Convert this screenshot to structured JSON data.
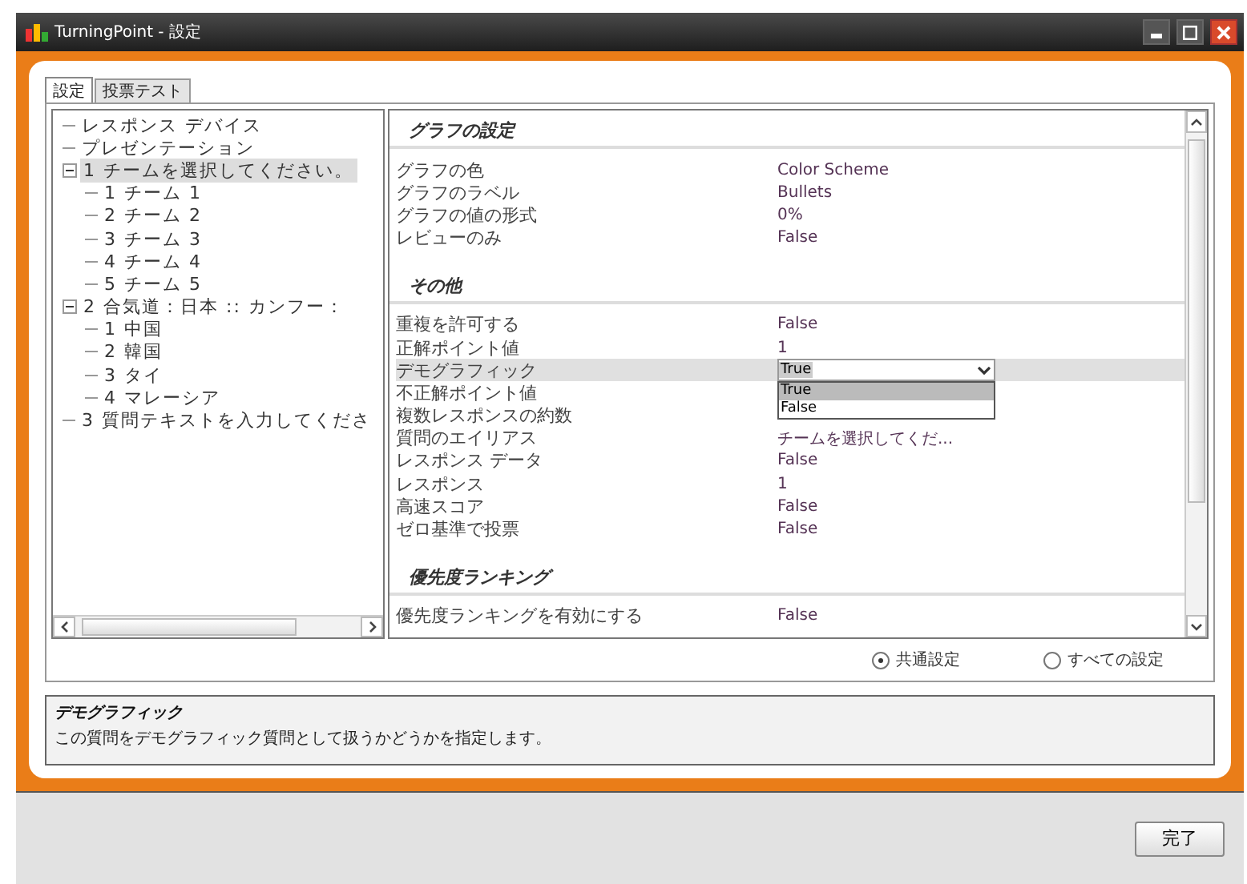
{
  "window": {
    "title": "TurningPoint - 設定"
  },
  "tabs": [
    {
      "label": "設定",
      "selected": true
    },
    {
      "label": "投票テスト",
      "selected": false
    }
  ],
  "tree": [
    {
      "label": "レスポンス デバイス",
      "selected": false
    },
    {
      "label": "プレゼンテーション",
      "selected": false
    },
    {
      "label": "1 チームを選択してください。",
      "selected": true,
      "expanded": true,
      "children": [
        {
          "label": "1 チーム 1",
          "selected": false
        },
        {
          "label": "2 チーム 2",
          "selected": false
        },
        {
          "label": "3 チーム 3",
          "selected": false
        },
        {
          "label": "4 チーム 4",
          "selected": false
        },
        {
          "label": "5 チーム 5",
          "selected": false
        }
      ]
    },
    {
      "label": "2 合気道：日本 :: カンフー：",
      "selected": false,
      "expanded": true,
      "children": [
        {
          "label": "1 中国",
          "selected": false
        },
        {
          "label": "2 韓国",
          "selected": false
        },
        {
          "label": "3 タイ",
          "selected": false
        },
        {
          "label": "4 マレーシア",
          "selected": false
        }
      ]
    },
    {
      "label": "3 質問テキストを入力してくださ",
      "selected": false
    }
  ],
  "properties": [
    {
      "title": "グラフの設定",
      "rows": [
        {
          "label": "グラフの色",
          "value": "Color Scheme",
          "selected": false
        },
        {
          "label": "グラフのラベル",
          "value": "Bullets",
          "selected": false
        },
        {
          "label": "グラフの値の形式",
          "value": "0%",
          "selected": false
        },
        {
          "label": "レビューのみ",
          "value": "False",
          "selected": false
        }
      ]
    },
    {
      "title": "その他",
      "rows": [
        {
          "label": "重複を許可する",
          "value": "False",
          "selected": false
        },
        {
          "label": "正解ポイント値",
          "value": "1",
          "selected": false
        },
        {
          "label": "デモグラフィック",
          "value": "True",
          "selected": true,
          "kind": "dropdown",
          "options": [
            {
              "label": "True",
              "selected": true
            },
            {
              "label": "False",
              "selected": false
            }
          ]
        },
        {
          "label": "不正解ポイント値",
          "selected": false
        },
        {
          "label": "複数レスポンスの約数",
          "selected": false
        },
        {
          "label": "質問のエイリアス",
          "value": "チームを選択してくだ...",
          "selected": false
        },
        {
          "label": "レスポンス データ",
          "value": "False",
          "selected": false
        },
        {
          "label": "レスポンス",
          "value": "1",
          "selected": false
        },
        {
          "label": "高速スコア",
          "value": "False",
          "selected": false
        },
        {
          "label": "ゼロ基準で投票",
          "value": "False",
          "selected": false
        }
      ]
    },
    {
      "title": "優先度ランキング",
      "rows": [
        {
          "label": "優先度ランキングを有効にする",
          "value": "False",
          "selected": false
        }
      ]
    }
  ],
  "scope": [
    {
      "label": "共通設定",
      "selected": true
    },
    {
      "label": "すべての設定",
      "selected": false
    }
  ],
  "description": {
    "title": "デモグラフィック",
    "text": "この質問をデモグラフィック質問として扱うかどうかを指定します。"
  },
  "buttons": [
    {
      "label": "完了"
    }
  ]
}
